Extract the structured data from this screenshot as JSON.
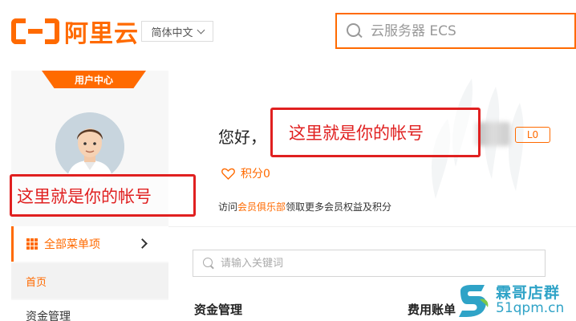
{
  "header": {
    "logo_text": "阿里云",
    "language": "简体中文",
    "search_placeholder": "云服务器 ECS"
  },
  "sidebar": {
    "user_center_tab": "用户中心",
    "all_menu_label": "全部菜单项",
    "home_label": "首页",
    "fund_label": "资金管理"
  },
  "profile": {
    "greeting": "您好，",
    "level_badge": "L0",
    "points_label": "积分0",
    "visit_prefix": "访问",
    "visit_link": "会员俱乐部",
    "visit_suffix": "领取更多会员权益及积分"
  },
  "content": {
    "keyword_placeholder": "请输入关键词",
    "section_fund": "资金管理",
    "section_bill": "费用账单"
  },
  "annotations": {
    "left_note": "这里就是你的帐号",
    "right_note": "这里就是你的帐号"
  },
  "watermark": {
    "line1": "霖哥店群",
    "line2": "51qpm.cn"
  },
  "colors": {
    "accent": "#ff6a00",
    "annotation": "#e02020",
    "watermark": "#2fa3c7"
  }
}
